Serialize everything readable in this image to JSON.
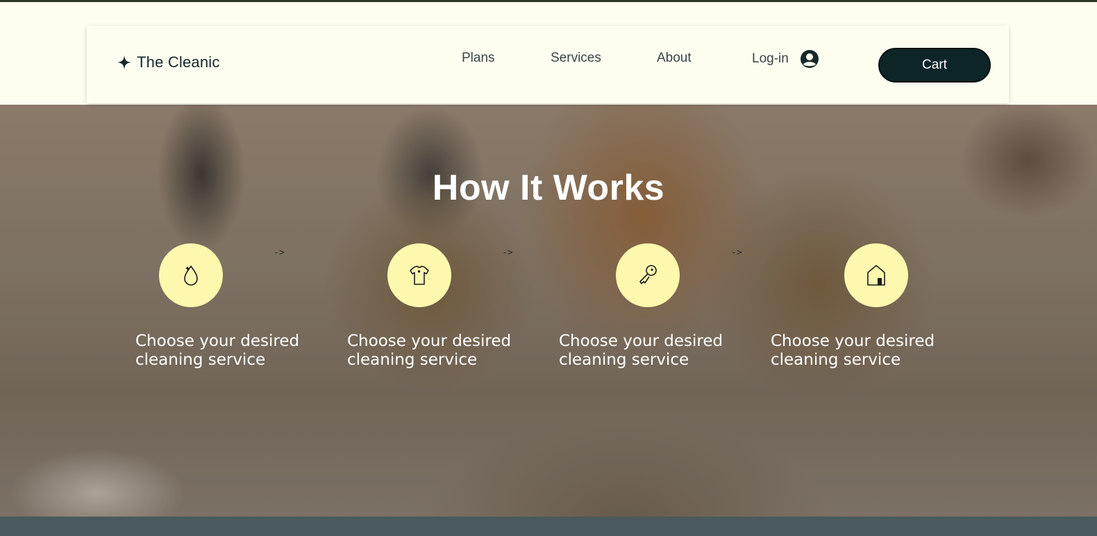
{
  "header": {
    "logo_text": "The Cleanic",
    "nav": {
      "plans": "Plans",
      "services": "Services",
      "about": "About"
    },
    "login_label": "Log-in",
    "cart_label": "Cart"
  },
  "hero": {
    "title": "How It Works",
    "arrows": [
      "->",
      "->",
      "->"
    ],
    "steps": [
      {
        "icon": "water-drop-icon",
        "text": "Choose your desired cleaning service"
      },
      {
        "icon": "shirt-icon",
        "text": "Choose your desired cleaning service"
      },
      {
        "icon": "key-icon",
        "text": "Choose your desired cleaning service"
      },
      {
        "icon": "house-icon",
        "text": "Choose your desired cleaning service"
      }
    ]
  },
  "colors": {
    "accent_circle": "#FEF8AE",
    "cart_button": "#0d2527",
    "header_bg": "#FEFEF0",
    "footer_band": "#4a5a5c"
  }
}
